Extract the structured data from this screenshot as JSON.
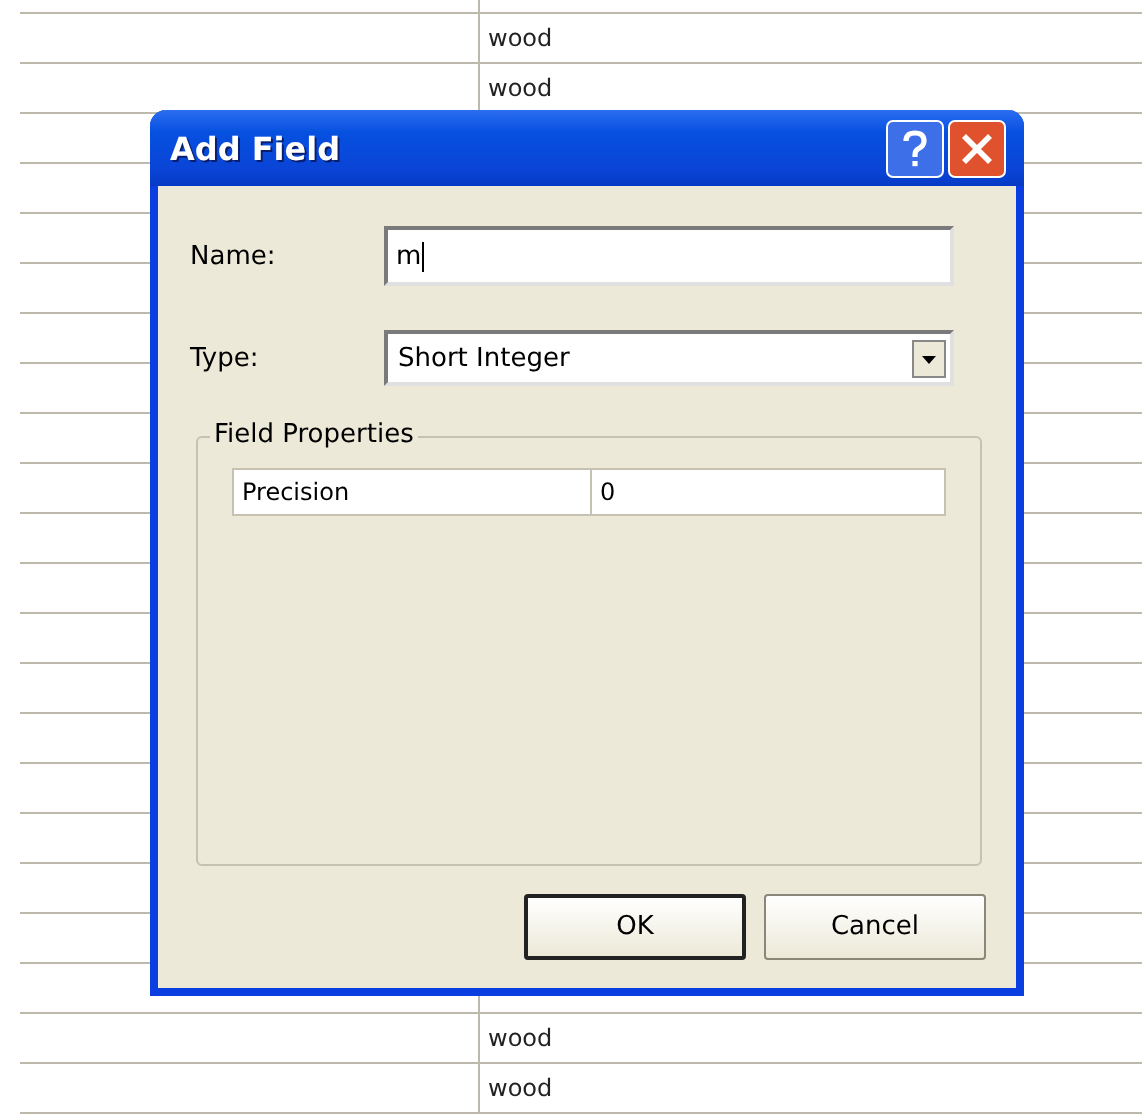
{
  "table": {
    "rows_top": [
      {
        "column_2": "wood"
      },
      {
        "column_2": "wood"
      }
    ],
    "rows_bottom": [
      {
        "column_2": "wood"
      },
      {
        "column_2": "wood"
      }
    ]
  },
  "dialog": {
    "title": "Add Field",
    "name_label": "Name:",
    "name_value": "m",
    "type_label": "Type:",
    "type_value": "Short Integer",
    "group_title": "Field Properties",
    "properties": [
      {
        "name": "Precision",
        "value": "0"
      }
    ],
    "buttons": [
      {
        "label": "OK",
        "default": true
      },
      {
        "label": "Cancel",
        "default": false
      }
    ]
  }
}
